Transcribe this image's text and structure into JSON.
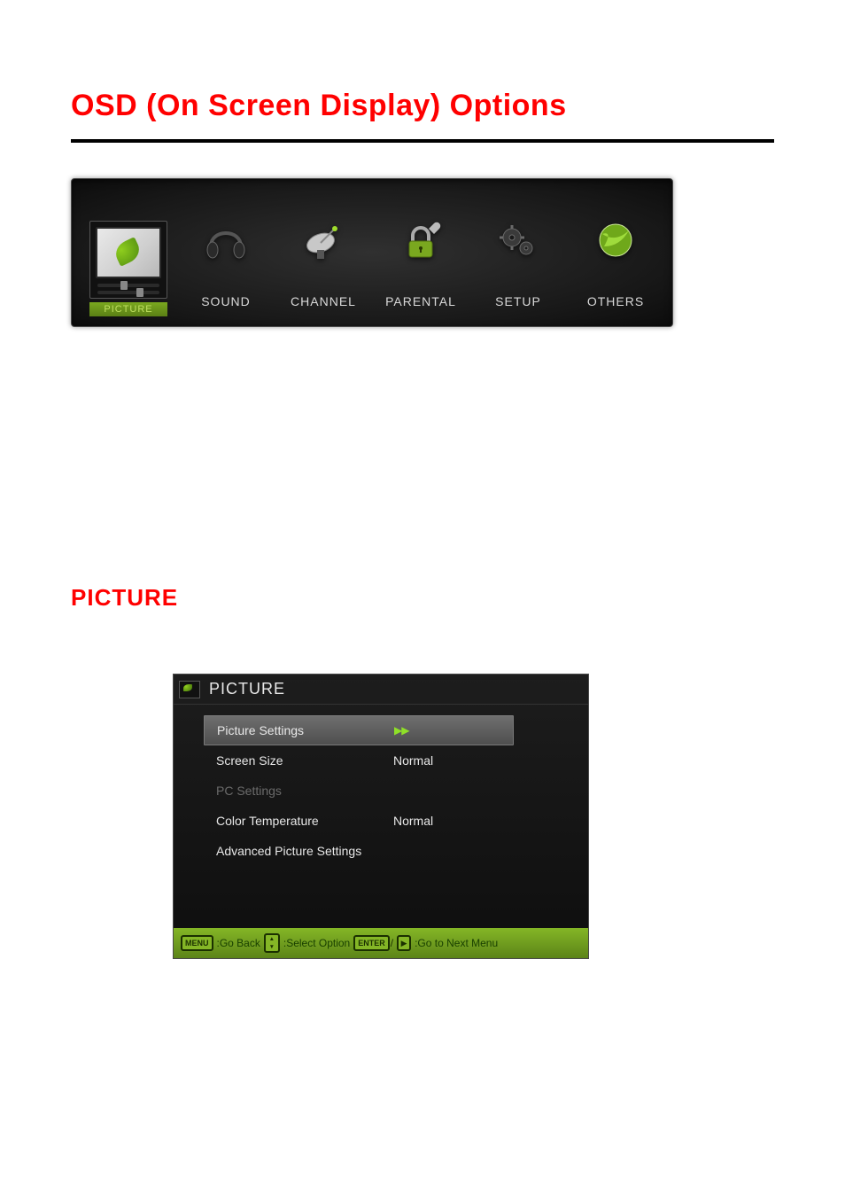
{
  "title": "OSD (On Screen Display) Options",
  "tabs": [
    {
      "label": "PICTURE",
      "icon": "monitor-leaf-icon",
      "active": true
    },
    {
      "label": "SOUND",
      "icon": "headphones-icon",
      "active": false
    },
    {
      "label": "CHANNEL",
      "icon": "satellite-dish-icon",
      "active": false
    },
    {
      "label": "PARENTAL",
      "icon": "padlock-icon",
      "active": false
    },
    {
      "label": "SETUP",
      "icon": "gears-icon",
      "active": false
    },
    {
      "label": "OTHERS",
      "icon": "globe-icon",
      "active": false
    }
  ],
  "section_heading": "PICTURE",
  "submenu": {
    "header": "PICTURE",
    "rows": [
      {
        "label": "Picture Settings",
        "value": "",
        "arrow": "▶▶",
        "selected": true,
        "disabled": false
      },
      {
        "label": "Screen Size",
        "value": "Normal",
        "arrow": "",
        "selected": false,
        "disabled": false
      },
      {
        "label": "PC Settings",
        "value": "",
        "arrow": "",
        "selected": false,
        "disabled": true
      },
      {
        "label": "Color Temperature",
        "value": "Normal",
        "arrow": "",
        "selected": false,
        "disabled": false
      },
      {
        "label": "Advanced Picture Settings",
        "value": "",
        "arrow": "",
        "selected": false,
        "disabled": false
      }
    ],
    "footer": {
      "menu_key": "MENU",
      "go_back": ":Go Back",
      "select_option": ":Select Option",
      "enter_key": "ENTER",
      "next_menu": ":Go to Next Menu"
    }
  }
}
